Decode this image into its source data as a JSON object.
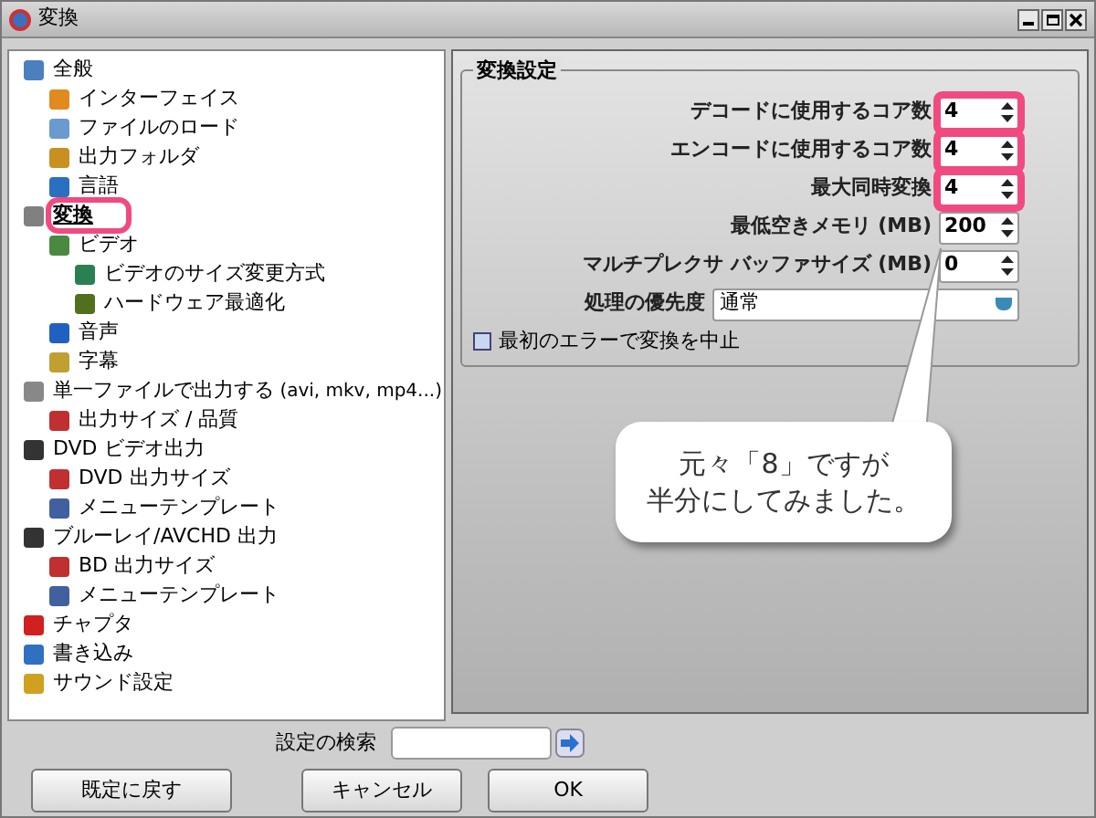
{
  "window": {
    "title": "変換"
  },
  "tree": [
    {
      "label": "全般",
      "selected": false,
      "children": [
        {
          "label": "インターフェイス",
          "selected": false
        },
        {
          "label": "ファイルのロード",
          "selected": false
        },
        {
          "label": "出力フォルダ",
          "selected": false
        },
        {
          "label": "言語",
          "selected": false
        }
      ]
    },
    {
      "label": "変換",
      "selected": true,
      "children": [
        {
          "label": "ビデオ",
          "selected": false,
          "children": [
            {
              "label": "ビデオのサイズ変更方式",
              "selected": false
            },
            {
              "label": "ハードウェア最適化",
              "selected": false
            }
          ]
        },
        {
          "label": "音声",
          "selected": false
        },
        {
          "label": "字幕",
          "selected": false
        }
      ]
    },
    {
      "label": "単一ファイルで出力する",
      "suffix": "(avi, mkv, mp4...)",
      "selected": false,
      "children": [
        {
          "label": "出力サイズ / 品質",
          "selected": false
        }
      ]
    },
    {
      "label": "DVD ビデオ出力",
      "selected": false,
      "children": [
        {
          "label": "DVD 出力サイズ",
          "selected": false
        },
        {
          "label": "メニューテンプレート",
          "selected": false
        }
      ]
    },
    {
      "label": "ブルーレイ/AVCHD 出力",
      "selected": false,
      "children": [
        {
          "label": "BD 出力サイズ",
          "selected": false
        },
        {
          "label": "メニューテンプレート",
          "selected": false
        }
      ]
    },
    {
      "label": "チャプタ",
      "selected": false
    },
    {
      "label": "書き込み",
      "selected": false
    },
    {
      "label": "サウンド設定",
      "selected": false
    }
  ],
  "group": {
    "title": "変換設定",
    "fields": [
      {
        "kind": "spin",
        "label": "デコードに使用するコア数",
        "value": "4",
        "highlighted": true
      },
      {
        "kind": "spin",
        "label": "エンコードに使用するコア数",
        "value": "4",
        "highlighted": true
      },
      {
        "kind": "spin",
        "label": "最大同時変換",
        "value": "4",
        "highlighted": true
      },
      {
        "kind": "spin",
        "label": "最低空きメモリ (MB)",
        "value": "200",
        "highlighted": false
      },
      {
        "kind": "spin",
        "label": "マルチプレクサ バッファサイズ (MB)",
        "value": "0",
        "highlighted": false
      },
      {
        "kind": "select",
        "label": "処理の優先度",
        "value": "通常",
        "highlighted": false
      }
    ],
    "checkbox": {
      "label": "最初のエラーで変換を中止",
      "checked": false
    }
  },
  "callout": {
    "lines": [
      "元々「8」ですが",
      "半分にしてみました。"
    ]
  },
  "search": {
    "label": "設定の検索"
  },
  "buttons": [
    "既定に戻す",
    "キャンセル",
    "OK"
  ]
}
